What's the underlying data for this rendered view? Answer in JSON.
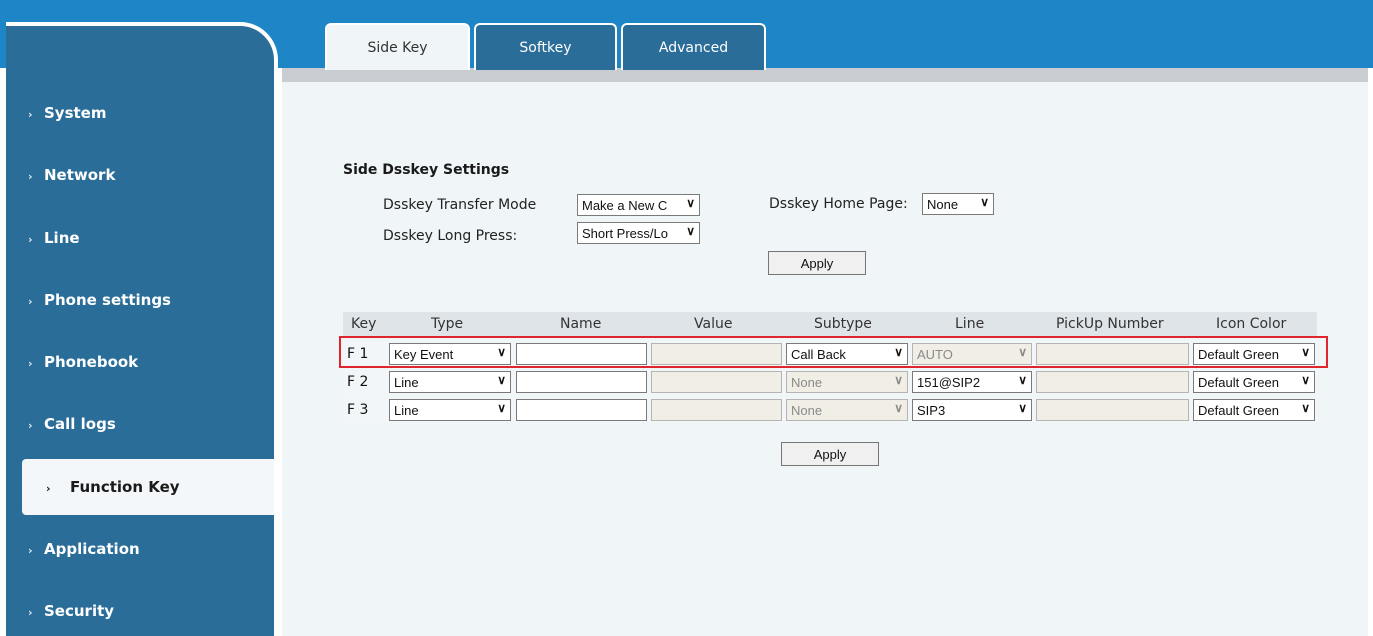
{
  "tabs": [
    {
      "label": "Side Key"
    },
    {
      "label": "Softkey"
    },
    {
      "label": "Advanced"
    }
  ],
  "sidebar": {
    "items": [
      {
        "label": "System"
      },
      {
        "label": "Network"
      },
      {
        "label": "Line"
      },
      {
        "label": "Phone settings"
      },
      {
        "label": "Phonebook"
      },
      {
        "label": "Call logs"
      },
      {
        "label": "Function Key"
      },
      {
        "label": "Application"
      },
      {
        "label": "Security"
      }
    ],
    "chevron": "›",
    "active_chevron": "›"
  },
  "settings": {
    "title": "Side Dsskey Settings",
    "transfer_mode_label": "Dsskey Transfer Mode",
    "transfer_mode_value": "Make a New C",
    "home_page_label": "Dsskey Home Page:",
    "home_page_value": "None",
    "long_press_label": "Dsskey Long Press:",
    "long_press_value": "Short Press/Lo",
    "apply_label": "Apply"
  },
  "table": {
    "headers": [
      "Key",
      "Type",
      "Name",
      "Value",
      "Subtype",
      "Line",
      "PickUp Number",
      "Icon Color"
    ],
    "rows": [
      {
        "key": "F 1",
        "type": "Key Event",
        "name": "",
        "value": "",
        "subtype": "Call Back",
        "line": "AUTO",
        "pickup": "",
        "icon_color": "Default Green"
      },
      {
        "key": "F 2",
        "type": "Line",
        "name": "",
        "value": "",
        "subtype": "None",
        "line": "151@SIP2",
        "pickup": "",
        "icon_color": "Default Green"
      },
      {
        "key": "F 3",
        "type": "Line",
        "name": "",
        "value": "",
        "subtype": "None",
        "line": "SIP3",
        "pickup": "",
        "icon_color": "Default Green"
      }
    ],
    "apply_label": "Apply"
  },
  "icons": {
    "dropdown": "chevron-down-icon",
    "sidebar": "chevron-right-icon"
  },
  "colors": {
    "banner": "#1e86c7",
    "sidebar": "#2a6d99",
    "content": "#f0f5f8",
    "highlight": "#e0262c"
  }
}
